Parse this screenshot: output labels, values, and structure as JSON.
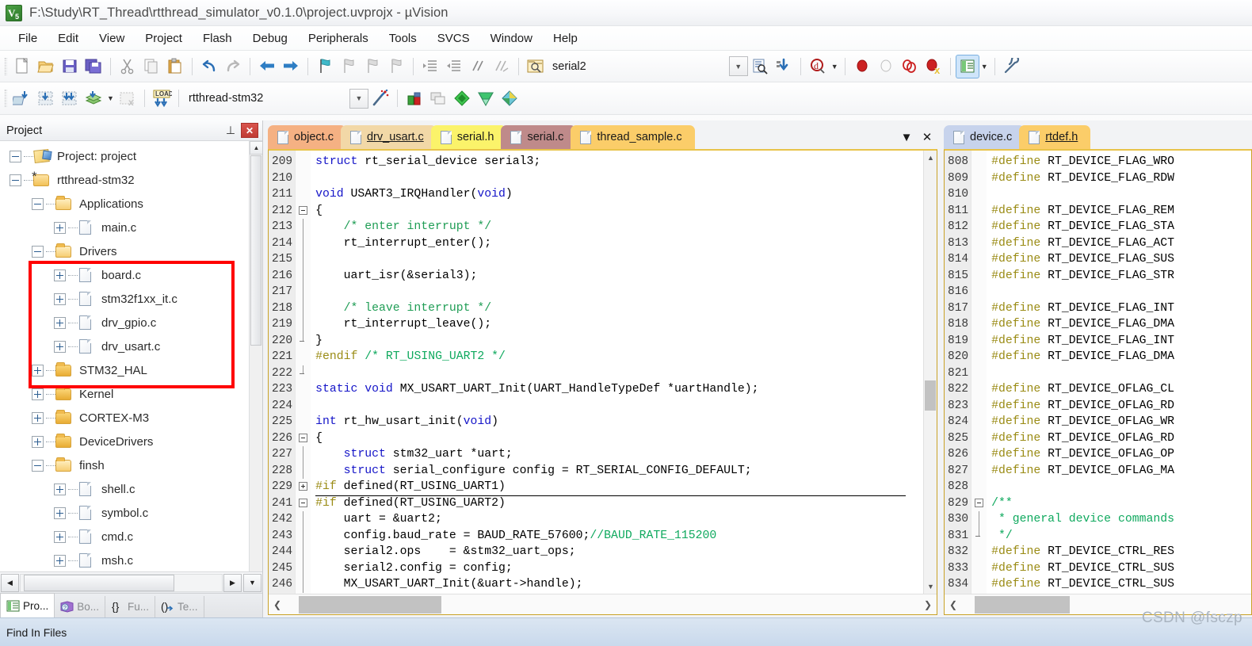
{
  "window": {
    "title": "F:\\Study\\RT_Thread\\rtthread_simulator_v0.1.0\\project.uvprojx - µVision",
    "app_icon": "uvision-icon"
  },
  "menubar": {
    "items": [
      {
        "label": "File"
      },
      {
        "label": "Edit"
      },
      {
        "label": "View"
      },
      {
        "label": "Project"
      },
      {
        "label": "Flash"
      },
      {
        "label": "Debug"
      },
      {
        "label": "Peripherals"
      },
      {
        "label": "Tools"
      },
      {
        "label": "SVCS"
      },
      {
        "label": "Window"
      },
      {
        "label": "Help"
      }
    ]
  },
  "toolbar_main": {
    "buttons": [
      {
        "name": "new-file-icon"
      },
      {
        "name": "open-file-icon"
      },
      {
        "name": "save-icon"
      },
      {
        "name": "save-all-icon"
      },
      {
        "name": "cut-icon"
      },
      {
        "name": "copy-icon"
      },
      {
        "name": "paste-icon"
      },
      {
        "name": "undo-icon"
      },
      {
        "name": "redo-icon"
      },
      {
        "name": "navigate-back-icon"
      },
      {
        "name": "navigate-forward-icon"
      },
      {
        "name": "bookmark-toggle-icon"
      },
      {
        "name": "bookmark-prev-icon"
      },
      {
        "name": "bookmark-next-icon"
      },
      {
        "name": "bookmark-clear-icon"
      },
      {
        "name": "indent-right-icon"
      },
      {
        "name": "indent-left-icon"
      },
      {
        "name": "comment-icon"
      },
      {
        "name": "uncomment-icon"
      }
    ],
    "file_label": "serial2",
    "find_icon": "find-in-files-icon",
    "goto_icon": "goto-icon",
    "debug_icon": "start-debug-icon",
    "breakpoint_icons": [
      "insert-breakpoint-icon",
      "disable-breakpoint-icon",
      "disable-all-breakpoints-icon",
      "kill-all-breakpoints-icon"
    ],
    "window_icon": "manage-windows-icon",
    "config_icon": "configuration-wizard-icon"
  },
  "toolbar_build": {
    "buttons": [
      {
        "name": "translate-icon"
      },
      {
        "name": "build-icon"
      },
      {
        "name": "rebuild-icon"
      },
      {
        "name": "batch-build-icon"
      },
      {
        "name": "stop-build-icon"
      },
      {
        "name": "download-icon"
      }
    ],
    "target": "rtthread-stm32",
    "target_select_icon": "chevron-down-icon",
    "magic_wand_icon": "options-for-target-icon",
    "right_buttons": [
      {
        "name": "manage-project-items-icon"
      },
      {
        "name": "multi-project-icon"
      },
      {
        "name": "pack-installer-icon"
      },
      {
        "name": "manage-run-time-env-icon"
      },
      {
        "name": "select-software-packs-icon"
      }
    ]
  },
  "project_panel": {
    "title": "Project",
    "pin_icon": "pin-icon",
    "close_icon": "close-icon",
    "tree": [
      {
        "label": "Project: project",
        "icon": "project-icon",
        "indent": 0,
        "state": "minus"
      },
      {
        "label": "rtthread-stm32",
        "icon": "target-icon",
        "indent": 1,
        "state": "minus"
      },
      {
        "label": "Applications",
        "icon": "folder-open-icon",
        "indent": 2,
        "state": "minus"
      },
      {
        "label": "main.c",
        "icon": "c-file-icon",
        "indent": 3,
        "state": "plus"
      },
      {
        "label": "Drivers",
        "icon": "folder-open-icon",
        "indent": 2,
        "state": "minus",
        "highlighted": true
      },
      {
        "label": "board.c",
        "icon": "c-file-icon",
        "indent": 3,
        "state": "plus",
        "highlighted": true
      },
      {
        "label": "stm32f1xx_it.c",
        "icon": "c-file-icon",
        "indent": 3,
        "state": "plus",
        "highlighted": true
      },
      {
        "label": "drv_gpio.c",
        "icon": "c-file-icon",
        "indent": 3,
        "state": "plus",
        "highlighted": true
      },
      {
        "label": "drv_usart.c",
        "icon": "c-file-icon",
        "indent": 3,
        "state": "plus",
        "highlighted": true
      },
      {
        "label": "STM32_HAL",
        "icon": "folder-closed-icon",
        "indent": 2,
        "state": "plus"
      },
      {
        "label": "Kernel",
        "icon": "folder-closed-icon",
        "indent": 2,
        "state": "plus"
      },
      {
        "label": "CORTEX-M3",
        "icon": "folder-closed-icon",
        "indent": 2,
        "state": "plus"
      },
      {
        "label": "DeviceDrivers",
        "icon": "folder-closed-icon",
        "indent": 2,
        "state": "plus"
      },
      {
        "label": "finsh",
        "icon": "folder-open-icon",
        "indent": 2,
        "state": "minus"
      },
      {
        "label": "shell.c",
        "icon": "c-file-icon",
        "indent": 3,
        "state": "plus"
      },
      {
        "label": "symbol.c",
        "icon": "c-file-icon",
        "indent": 3,
        "state": "plus"
      },
      {
        "label": "cmd.c",
        "icon": "c-file-icon",
        "indent": 3,
        "state": "plus"
      },
      {
        "label": "msh.c",
        "icon": "c-file-icon",
        "indent": 3,
        "state": "plus"
      }
    ],
    "bottom_tabs": [
      {
        "label": "Pro...",
        "icon": "project-tab-icon",
        "selected": true
      },
      {
        "label": "Bo...",
        "icon": "books-tab-icon",
        "selected": false
      },
      {
        "label": "Fu...",
        "icon": "functions-tab-icon",
        "selected": false
      },
      {
        "label": "Te...",
        "icon": "templates-tab-icon",
        "selected": false
      }
    ],
    "highlight_color": "#ff0000"
  },
  "editor_left": {
    "tabs": [
      {
        "label": "object.c",
        "color": "#f5b183",
        "active": false
      },
      {
        "label": "drv_usart.c",
        "color": "#f2d8a7",
        "active": true
      },
      {
        "label": "serial.h",
        "color": "#fbf36a",
        "active": false
      },
      {
        "label": "serial.c",
        "color": "#bf8a8a",
        "active": false
      },
      {
        "label": "thread_sample.c",
        "color": "#fbcd69",
        "active": false
      }
    ],
    "tab_controls": [
      {
        "name": "tab-list-icon",
        "glyph": "▼"
      },
      {
        "name": "close-tab-icon",
        "glyph": "✕"
      }
    ],
    "lines": [
      {
        "num": "209",
        "fold": "",
        "tokens": [
          {
            "t": "struct",
            "c": "kw"
          },
          {
            "t": " rt_serial_device serial3;",
            "c": ""
          }
        ]
      },
      {
        "num": "210",
        "fold": "",
        "tokens": []
      },
      {
        "num": "211",
        "fold": "",
        "tokens": [
          {
            "t": "void",
            "c": "kw"
          },
          {
            "t": " USART3_IRQHandler(",
            "c": ""
          },
          {
            "t": "void",
            "c": "kw"
          },
          {
            "t": ")",
            "c": ""
          }
        ]
      },
      {
        "num": "212",
        "fold": "minus",
        "tokens": [
          {
            "t": "{",
            "c": ""
          }
        ]
      },
      {
        "num": "213",
        "fold": "bar",
        "tokens": [
          {
            "t": "    /* enter interrupt */",
            "c": "cm"
          }
        ]
      },
      {
        "num": "214",
        "fold": "bar",
        "tokens": [
          {
            "t": "    rt_interrupt_enter();",
            "c": ""
          }
        ]
      },
      {
        "num": "215",
        "fold": "bar",
        "tokens": []
      },
      {
        "num": "216",
        "fold": "bar",
        "tokens": [
          {
            "t": "    uart_isr(&serial3);",
            "c": ""
          }
        ]
      },
      {
        "num": "217",
        "fold": "bar",
        "tokens": []
      },
      {
        "num": "218",
        "fold": "bar",
        "tokens": [
          {
            "t": "    /* leave interrupt */",
            "c": "cm"
          }
        ]
      },
      {
        "num": "219",
        "fold": "bar",
        "tokens": [
          {
            "t": "    rt_interrupt_leave();",
            "c": ""
          }
        ]
      },
      {
        "num": "220",
        "fold": "end",
        "tokens": [
          {
            "t": "}",
            "c": ""
          }
        ]
      },
      {
        "num": "221",
        "fold": "",
        "tokens": [
          {
            "t": "#endif",
            "c": "pp"
          },
          {
            "t": " ",
            "c": ""
          },
          {
            "t": "/* RT_USING_UART2 */",
            "c": "cm2"
          }
        ]
      },
      {
        "num": "222",
        "fold": "end",
        "tokens": []
      },
      {
        "num": "223",
        "fold": "",
        "tokens": [
          {
            "t": "static",
            "c": "kw"
          },
          {
            "t": " ",
            "c": ""
          },
          {
            "t": "void",
            "c": "kw"
          },
          {
            "t": " MX_USART_UART_Init(UART_HandleTypeDef *uartHandle);",
            "c": ""
          }
        ]
      },
      {
        "num": "224",
        "fold": "",
        "tokens": []
      },
      {
        "num": "225",
        "fold": "",
        "tokens": [
          {
            "t": "int",
            "c": "kw"
          },
          {
            "t": " rt_hw_usart_init(",
            "c": ""
          },
          {
            "t": "void",
            "c": "kw"
          },
          {
            "t": ")",
            "c": ""
          }
        ]
      },
      {
        "num": "226",
        "fold": "minus",
        "tokens": [
          {
            "t": "{",
            "c": ""
          }
        ]
      },
      {
        "num": "227",
        "fold": "bar",
        "tokens": [
          {
            "t": "    ",
            "c": ""
          },
          {
            "t": "struct",
            "c": "kw"
          },
          {
            "t": " stm32_uart *uart;",
            "c": ""
          }
        ]
      },
      {
        "num": "228",
        "fold": "bar",
        "tokens": [
          {
            "t": "    ",
            "c": ""
          },
          {
            "t": "struct",
            "c": "kw"
          },
          {
            "t": " serial_configure config = RT_SERIAL_CONFIG_DEFAULT;",
            "c": ""
          }
        ]
      },
      {
        "num": "229",
        "fold": "plus",
        "collapsed": true,
        "tokens": [
          {
            "t": "#if",
            "c": "pp"
          },
          {
            "t": " defined(RT_USING_UART1)",
            "c": ""
          }
        ]
      },
      {
        "num": "241",
        "fold": "minus",
        "tokens": [
          {
            "t": "#if",
            "c": "pp"
          },
          {
            "t": " defined(RT_USING_UART2)",
            "c": ""
          }
        ]
      },
      {
        "num": "242",
        "fold": "bar",
        "tokens": [
          {
            "t": "    uart = &uart2;",
            "c": ""
          }
        ]
      },
      {
        "num": "243",
        "fold": "bar",
        "tokens": [
          {
            "t": "    config.baud_rate = BAUD_RATE_57600;",
            "c": ""
          },
          {
            "t": "//BAUD_RATE_115200",
            "c": "cm2"
          }
        ]
      },
      {
        "num": "244",
        "fold": "bar",
        "tokens": [
          {
            "t": "    serial2.ops    = &stm32_uart_ops;",
            "c": ""
          }
        ]
      },
      {
        "num": "245",
        "fold": "bar",
        "tokens": [
          {
            "t": "    serial2.config = config;",
            "c": ""
          }
        ]
      },
      {
        "num": "246",
        "fold": "bar",
        "tokens": [
          {
            "t": "    MX_USART_UART_Init(&uart->handle);",
            "c": ""
          }
        ]
      }
    ]
  },
  "editor_right": {
    "tabs": [
      {
        "label": "device.c",
        "color": "#c7d3ec",
        "active": false
      },
      {
        "label": "rtdef.h",
        "color": "#fbcd69",
        "active": true
      }
    ],
    "lines": [
      {
        "num": "808",
        "fold": "",
        "tokens": [
          {
            "t": "#define",
            "c": "pp"
          },
          {
            "t": " RT_DEVICE_FLAG_WRO",
            "c": ""
          }
        ]
      },
      {
        "num": "809",
        "fold": "",
        "tokens": [
          {
            "t": "#define",
            "c": "pp"
          },
          {
            "t": " RT_DEVICE_FLAG_RDW",
            "c": ""
          }
        ]
      },
      {
        "num": "810",
        "fold": "",
        "tokens": []
      },
      {
        "num": "811",
        "fold": "",
        "tokens": [
          {
            "t": "#define",
            "c": "pp"
          },
          {
            "t": " RT_DEVICE_FLAG_REM",
            "c": ""
          }
        ]
      },
      {
        "num": "812",
        "fold": "",
        "tokens": [
          {
            "t": "#define",
            "c": "pp"
          },
          {
            "t": " RT_DEVICE_FLAG_STA",
            "c": ""
          }
        ]
      },
      {
        "num": "813",
        "fold": "",
        "tokens": [
          {
            "t": "#define",
            "c": "pp"
          },
          {
            "t": " RT_DEVICE_FLAG_ACT",
            "c": ""
          }
        ]
      },
      {
        "num": "814",
        "fold": "",
        "tokens": [
          {
            "t": "#define",
            "c": "pp"
          },
          {
            "t": " RT_DEVICE_FLAG_SUS",
            "c": ""
          }
        ]
      },
      {
        "num": "815",
        "fold": "",
        "tokens": [
          {
            "t": "#define",
            "c": "pp"
          },
          {
            "t": " RT_DEVICE_FLAG_STR",
            "c": ""
          }
        ]
      },
      {
        "num": "816",
        "fold": "",
        "tokens": []
      },
      {
        "num": "817",
        "fold": "",
        "tokens": [
          {
            "t": "#define",
            "c": "pp"
          },
          {
            "t": " RT_DEVICE_FLAG_INT",
            "c": ""
          }
        ]
      },
      {
        "num": "818",
        "fold": "",
        "tokens": [
          {
            "t": "#define",
            "c": "pp"
          },
          {
            "t": " RT_DEVICE_FLAG_DMA",
            "c": ""
          }
        ]
      },
      {
        "num": "819",
        "fold": "",
        "tokens": [
          {
            "t": "#define",
            "c": "pp"
          },
          {
            "t": " RT_DEVICE_FLAG_INT",
            "c": ""
          }
        ]
      },
      {
        "num": "820",
        "fold": "",
        "tokens": [
          {
            "t": "#define",
            "c": "pp"
          },
          {
            "t": " RT_DEVICE_FLAG_DMA",
            "c": ""
          }
        ]
      },
      {
        "num": "821",
        "fold": "",
        "tokens": []
      },
      {
        "num": "822",
        "fold": "",
        "tokens": [
          {
            "t": "#define",
            "c": "pp"
          },
          {
            "t": " RT_DEVICE_OFLAG_CL",
            "c": ""
          }
        ]
      },
      {
        "num": "823",
        "fold": "",
        "tokens": [
          {
            "t": "#define",
            "c": "pp"
          },
          {
            "t": " RT_DEVICE_OFLAG_RD",
            "c": ""
          }
        ]
      },
      {
        "num": "824",
        "fold": "",
        "tokens": [
          {
            "t": "#define",
            "c": "pp"
          },
          {
            "t": " RT_DEVICE_OFLAG_WR",
            "c": ""
          }
        ]
      },
      {
        "num": "825",
        "fold": "",
        "tokens": [
          {
            "t": "#define",
            "c": "pp"
          },
          {
            "t": " RT_DEVICE_OFLAG_RD",
            "c": ""
          }
        ]
      },
      {
        "num": "826",
        "fold": "",
        "tokens": [
          {
            "t": "#define",
            "c": "pp"
          },
          {
            "t": " RT_DEVICE_OFLAG_OP",
            "c": ""
          }
        ]
      },
      {
        "num": "827",
        "fold": "",
        "tokens": [
          {
            "t": "#define",
            "c": "pp"
          },
          {
            "t": " RT_DEVICE_OFLAG_MA",
            "c": ""
          }
        ]
      },
      {
        "num": "828",
        "fold": "",
        "tokens": []
      },
      {
        "num": "829",
        "fold": "minus",
        "tokens": [
          {
            "t": "/**",
            "c": "cm2"
          }
        ]
      },
      {
        "num": "830",
        "fold": "bar",
        "tokens": [
          {
            "t": " * general device commands",
            "c": "cm2"
          }
        ]
      },
      {
        "num": "831",
        "fold": "end",
        "tokens": [
          {
            "t": " */",
            "c": "cm2"
          }
        ]
      },
      {
        "num": "832",
        "fold": "",
        "tokens": [
          {
            "t": "#define",
            "c": "pp"
          },
          {
            "t": " RT_DEVICE_CTRL_RES",
            "c": ""
          }
        ]
      },
      {
        "num": "833",
        "fold": "",
        "tokens": [
          {
            "t": "#define",
            "c": "pp"
          },
          {
            "t": " RT_DEVICE_CTRL_SUS",
            "c": ""
          }
        ]
      },
      {
        "num": "834",
        "fold": "",
        "tokens": [
          {
            "t": "#define",
            "c": "pp"
          },
          {
            "t": " RT_DEVICE_CTRL_SUS",
            "c": ""
          }
        ]
      }
    ]
  },
  "statusbar": {
    "text": "Find In Files"
  },
  "watermark": {
    "text": "CSDN @fsczp"
  }
}
